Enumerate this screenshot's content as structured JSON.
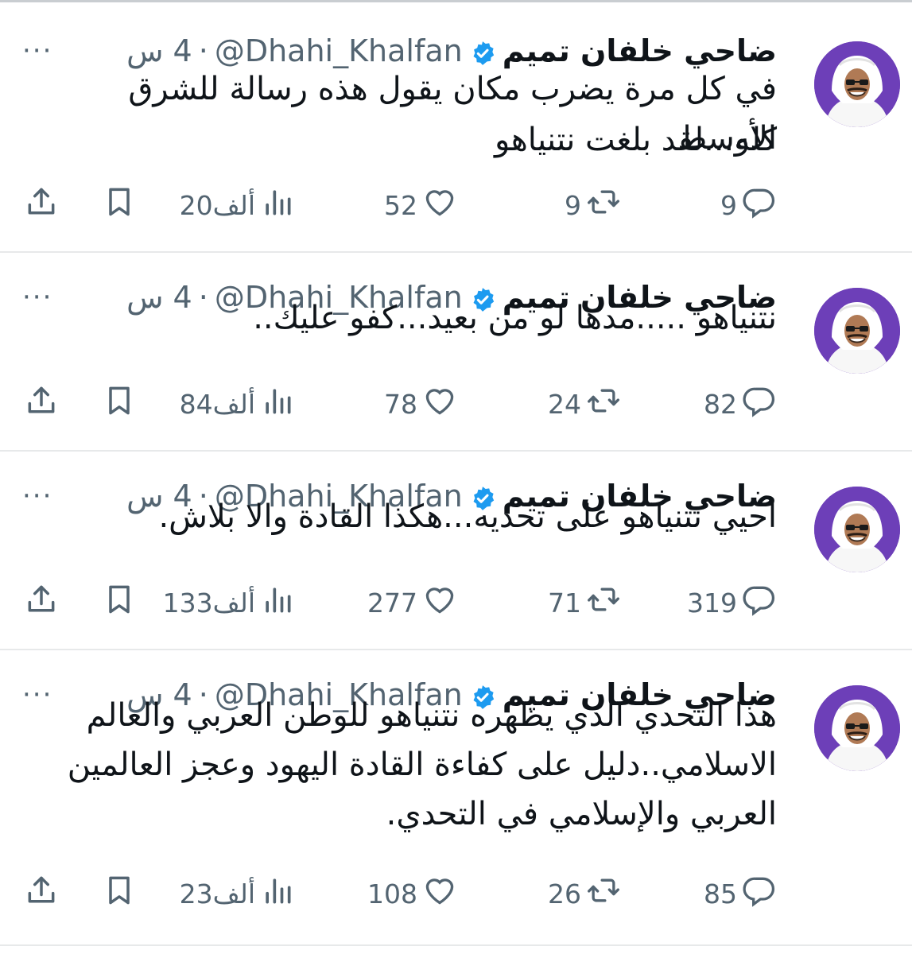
{
  "tweets": [
    {
      "name": "ضاحي خلفان تميم",
      "handle": "@Dhahi_Khalfan",
      "dot": "·",
      "time": "4 س",
      "more": "···",
      "text_lines": [
        "في كل مرة يضرب مكان يقول هذه رسالة للشرق الأوسط",
        "كله...لقد بلغت نتنياهو"
      ],
      "replies": "9",
      "retweets": "9",
      "likes": "52",
      "views": "20ألف"
    },
    {
      "name": "ضاحي خلفان تميم",
      "handle": "@Dhahi_Khalfan",
      "dot": "·",
      "time": "4 س",
      "more": "···",
      "text_lines": [
        "نتنياهو .....مدها لو من بعيد...كفو عليك.."
      ],
      "replies": "82",
      "retweets": "24",
      "likes": "78",
      "views": "84ألف"
    },
    {
      "name": "ضاحي خلفان تميم",
      "handle": "@Dhahi_Khalfan",
      "dot": "·",
      "time": "4 س",
      "more": "···",
      "text_lines": [
        "احيي نتنياهو على تحديه...هكذا القادة والا بلاش."
      ],
      "replies": "319",
      "retweets": "71",
      "likes": "277",
      "views": "133ألف"
    },
    {
      "name": "ضاحي خلفان تميم",
      "handle": "@Dhahi_Khalfan",
      "dot": "·",
      "time": "4 س",
      "more": "···",
      "text_lines": [
        "هذا التحدي الذي يظهره نتنياهو للوطن العربي والعالم",
        "الاسلامي..دليل على كفاءة القادة اليهود وعجز العالمين",
        "العربي والإسلامي في التحدي."
      ],
      "replies": "85",
      "retweets": "26",
      "likes": "108",
      "views": "23ألف"
    }
  ],
  "icons": {
    "reply": "reply-icon",
    "retweet": "retweet-icon",
    "like": "heart-icon",
    "views": "views-icon",
    "bookmark": "bookmark-icon",
    "share": "share-icon",
    "verified": "verified-badge-icon"
  },
  "colors": {
    "verified": "#1d9bf0",
    "muted": "#536471",
    "text": "#0f1419",
    "avatar_bg": "#6d3fb8"
  }
}
